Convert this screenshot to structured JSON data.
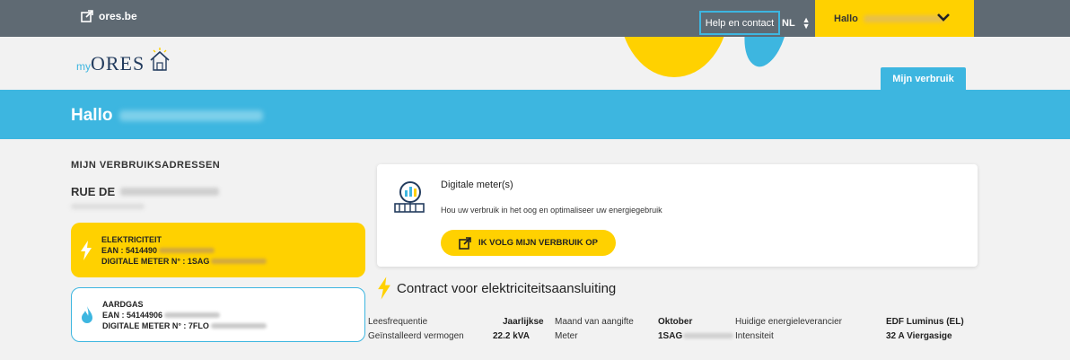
{
  "topbar": {
    "brand_link": "ores.be",
    "help": "Help en contact",
    "lang": "NL",
    "hello": "Hallo"
  },
  "header": {
    "logo_my": "my",
    "logo_ores": "ORES",
    "tab": "Mijn verbruik"
  },
  "banner": {
    "title": "Hallo"
  },
  "addresses": {
    "section_title": "MIJN VERBRUIKSADRESSEN",
    "street": "RUE DE",
    "electricity": {
      "name": "ELEKTRICITEIT",
      "ean": "EAN : 5414490",
      "meter": "DIGITALE METER N° : 1SAG"
    },
    "gas": {
      "name": "AARDGAS",
      "ean": "EAN : 54144906",
      "meter": "DIGITALE METER N° : 7FLO"
    }
  },
  "meter_card": {
    "title": "Digitale meter(s)",
    "subtitle": "Hou uw verbruik in het oog en optimaliseer uw energiegebruik",
    "button": "IK VOLG MIJN VERBRUIK OP"
  },
  "contract": {
    "title": "Contract voor elektriciteitsaansluiting",
    "leesfrequentie_label": "Leesfrequentie",
    "leesfrequentie_value": "Jaarlijkse",
    "maand_label": "Maand van aangifte",
    "maand_value": "Oktober",
    "leverancier_label": "Huidige energieleverancier",
    "leverancier_value": "EDF Luminus (EL)",
    "vermogen_label": "Geïnstalleerd vermogen",
    "vermogen_value": "22.2 kVA",
    "meter_label": "Meter",
    "meter_value": "1SAG",
    "intensiteit_label": "Intensiteit",
    "intensiteit_value": "32 A Viergasige"
  },
  "colors": {
    "topbar": "#5f6a73",
    "yellow": "#ffd100",
    "blue": "#3db6e0",
    "background": "#f2f2f2"
  },
  "icons": [
    "external-link-icon",
    "chevron-down-icon",
    "house-logo-icon",
    "lightning-icon",
    "flame-icon",
    "meter-search-icon"
  ]
}
